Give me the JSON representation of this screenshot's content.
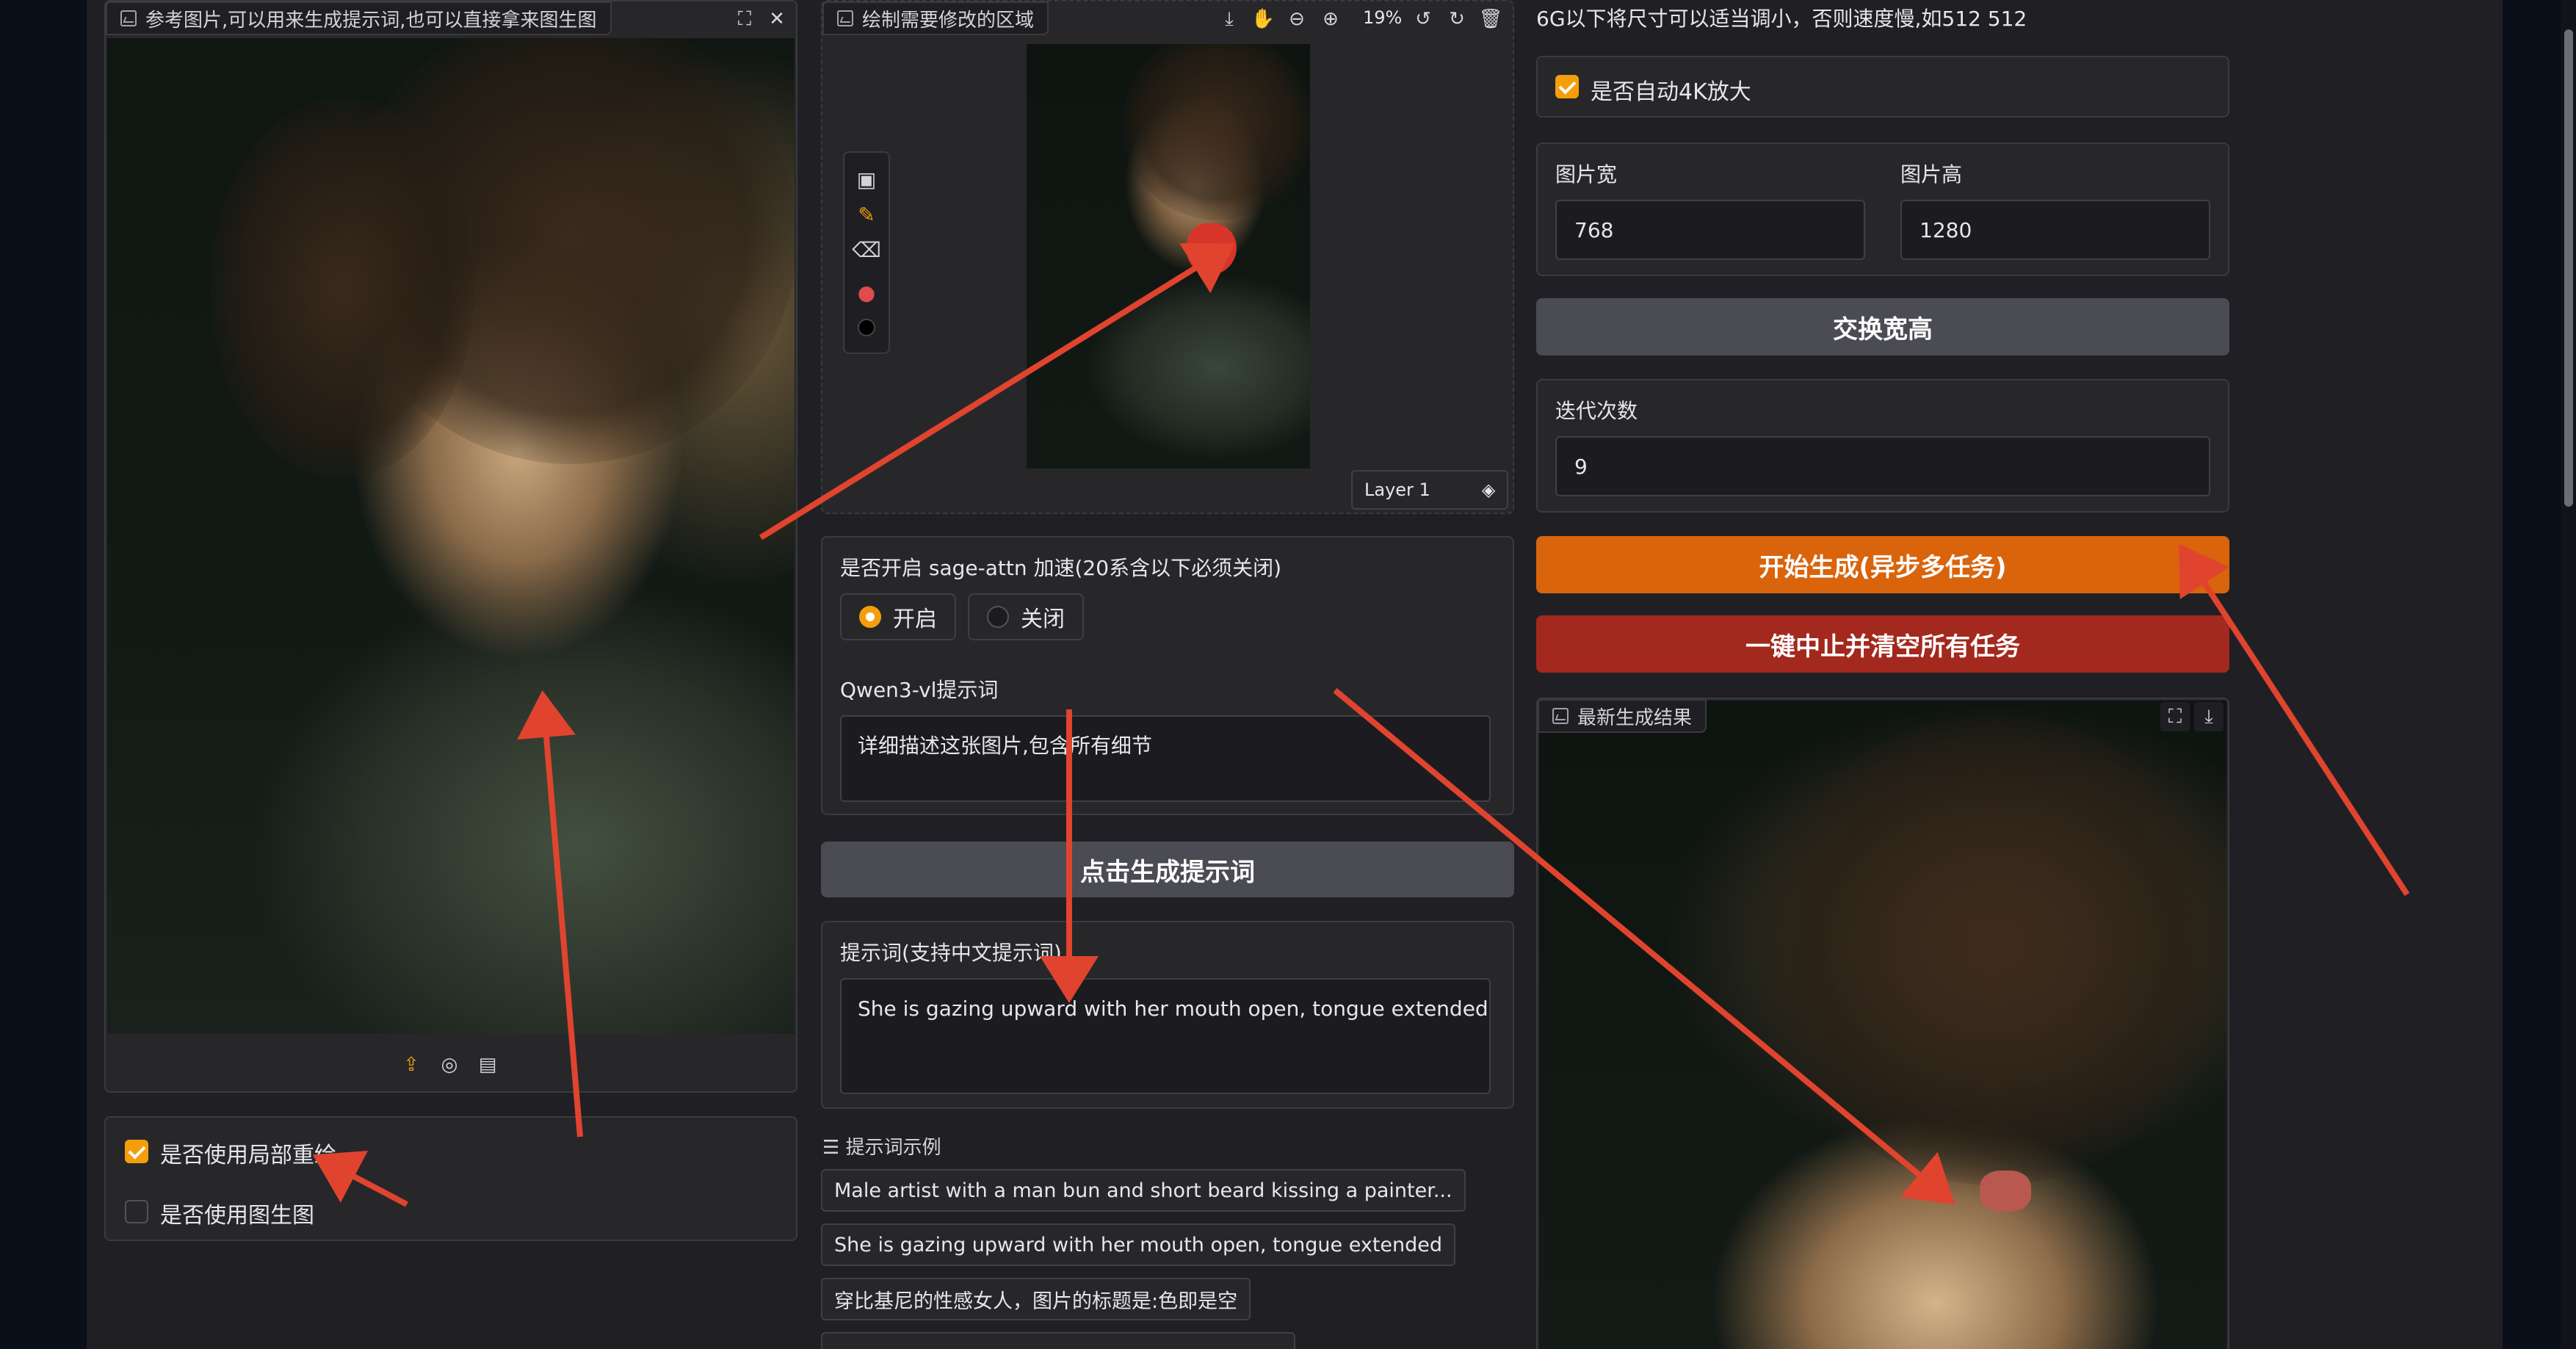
{
  "reference_panel": {
    "label": "参考图片,可以用来生成提示词,也可以直接拿来图生图",
    "icons": [
      "fullscreen-icon",
      "close-icon"
    ],
    "bottom_icons": [
      "upload-icon",
      "webcam-icon",
      "clipboard-icon"
    ]
  },
  "options": {
    "inpaint_label": "是否使用局部重绘",
    "inpaint_checked": true,
    "img2img_label": "是否使用图生图",
    "img2img_checked": false
  },
  "editor": {
    "label": "绘制需要修改的区域",
    "zoom": "19%",
    "layer": "Layer 1",
    "tools": [
      "image-icon",
      "brush-icon",
      "eraser-icon",
      "palette-icon",
      "color-swatch-icon"
    ],
    "top_icons": [
      "download-icon",
      "pan-icon",
      "zoom-out-icon",
      "zoom-in-icon",
      "undo-icon",
      "redo-icon",
      "delete-icon"
    ],
    "mask_color": "#d8352a"
  },
  "sage_attn": {
    "label": "是否开启 sage-attn 加速(20系含以下必须关闭)",
    "options": [
      "开启",
      "关闭"
    ],
    "selected": "开启"
  },
  "qwen": {
    "label": "Qwen3-vl提示词",
    "value": "详细描述这张图片,包含所有细节"
  },
  "generate_prompt_button": "点击生成提示词",
  "prompt": {
    "label": "提示词(支持中文提示词)",
    "value": "She is gazing upward with her mouth open, tongue extended"
  },
  "examples": {
    "label": "提示词示例",
    "items": [
      "Male artist with a man bun and short beard kissing a painter...",
      "She is gazing upward with her mouth open, tongue extended",
      "穿比基尼的性感女人，图片的标题是:色即是空"
    ]
  },
  "right": {
    "note": "6G以下将尺寸可以适当调小，否则速度慢,如512 512",
    "auto4k_label": "是否自动4K放大",
    "auto4k_checked": true,
    "width_label": "图片宽",
    "width_value": "768",
    "height_label": "图片高",
    "height_value": "1280",
    "swap_button": "交换宽高",
    "steps_label": "迭代次数",
    "steps_value": "9",
    "start_button": "开始生成(异步多任务)",
    "stop_button": "一键中止并清空所有任务",
    "result_label": "最新生成结果",
    "result_icons": [
      "fullscreen-icon",
      "download-icon"
    ]
  },
  "colors": {
    "accent_orange": "#d9640c",
    "stop_red": "#a3281d",
    "checkbox_orange": "#f59e0b",
    "annotation_arrow": "#e0442e"
  }
}
